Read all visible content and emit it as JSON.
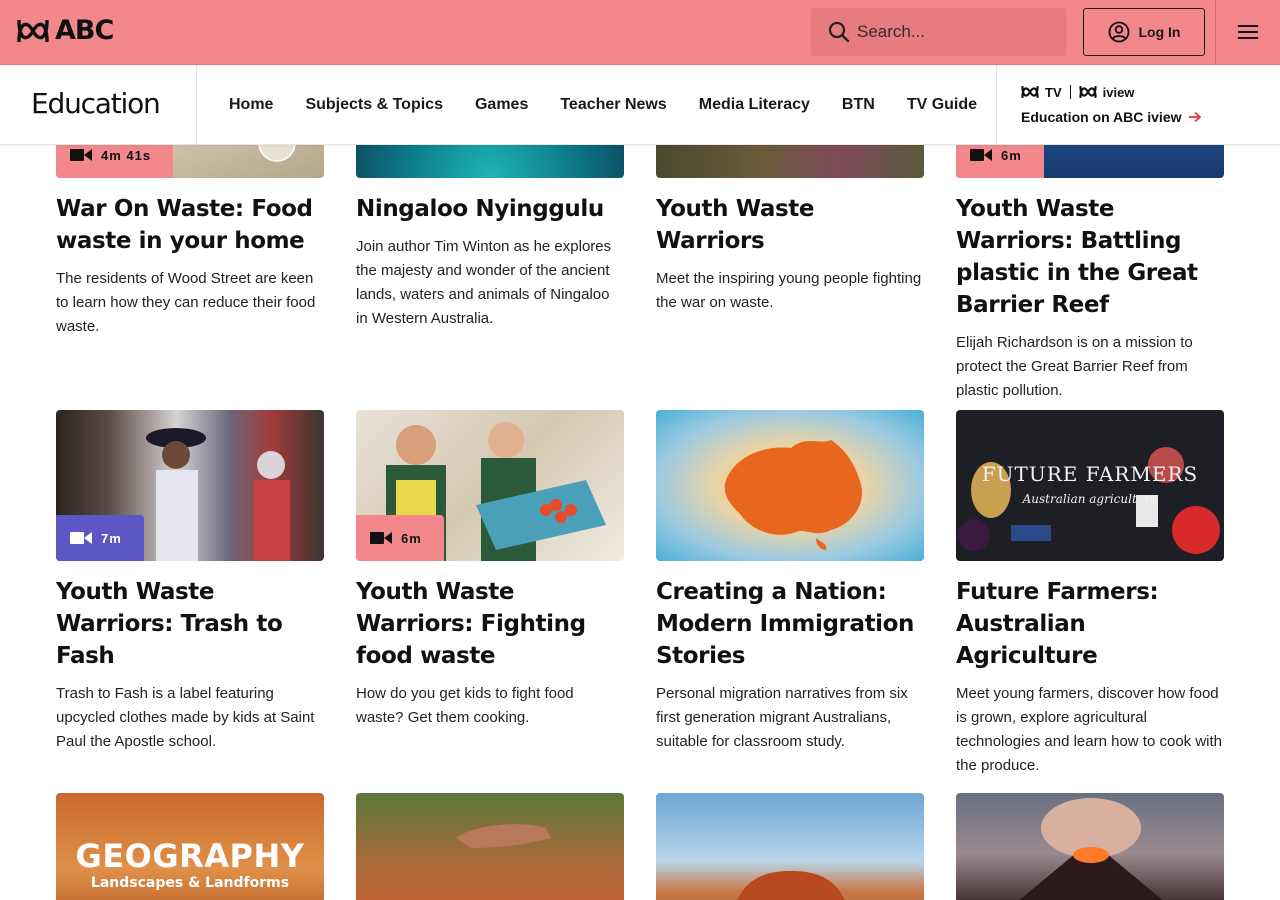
{
  "header": {
    "logo_text": "ABC",
    "search_placeholder": "Search...",
    "login_label": "Log In"
  },
  "subnav": {
    "brand": "Education",
    "links": [
      "Home",
      "Subjects & Topics",
      "Games",
      "Teacher News",
      "Media Literacy",
      "BTN",
      "TV Guide"
    ],
    "iview": {
      "tv": "TV",
      "iview": "iview",
      "link": "Education on ABC iview"
    }
  },
  "cards": [
    {
      "title": "War On Waste: Food waste in your home",
      "description": "The residents of Wood Street are keen to learn how they can reduce their food waste.",
      "duration": "4m 41s",
      "badge": "pink"
    },
    {
      "title": "Ningaloo Nyinggulu",
      "description": "Join author Tim Winton as he explores the majesty and wonder of the ancient lands, waters and animals of Ningaloo in Western Australia.",
      "duration": "",
      "badge": ""
    },
    {
      "title": "Youth Waste Warriors",
      "description": "Meet the inspiring young people fighting the war on waste.",
      "duration": "",
      "badge": ""
    },
    {
      "title": "Youth Waste Warriors: Battling plastic in the Great Barrier Reef",
      "description": "Elijah Richardson is on a mission to protect the Great Barrier Reef from plastic pollution.",
      "duration": "6m",
      "badge": "pink"
    },
    {
      "title": "Youth Waste Warriors: Trash to Fash",
      "description": "Trash to Fash is a label featuring upcycled clothes made by kids at Saint Paul the Apostle school.",
      "duration": "7m",
      "badge": "purple"
    },
    {
      "title": "Youth Waste Warriors: Fighting food waste",
      "description": "How do you get kids to fight food waste? Get them cooking.",
      "duration": "6m",
      "badge": "pink"
    },
    {
      "title": "Creating a Nation: Modern Immigration Stories",
      "description": "Personal migration narratives from six first generation migrant Australians, suitable for classroom study.",
      "duration": "",
      "badge": ""
    },
    {
      "title": "Future Farmers: Australian Agriculture",
      "description": "Meet young farmers, discover how food is grown, explore agricultural technologies and learn how to cook with the produce.",
      "duration": "",
      "badge": ""
    }
  ],
  "thumb_text": {
    "future_farmers_title": "FUTURE FARMERS",
    "future_farmers_sub": "Australian agriculture",
    "geography_title": "GEOGRAPHY",
    "geography_sub": "Landscapes & Landforms"
  },
  "colors": {
    "header_bg": "#f2878c",
    "badge_pink": "#f2878c",
    "badge_purple": "#5c57c4"
  }
}
